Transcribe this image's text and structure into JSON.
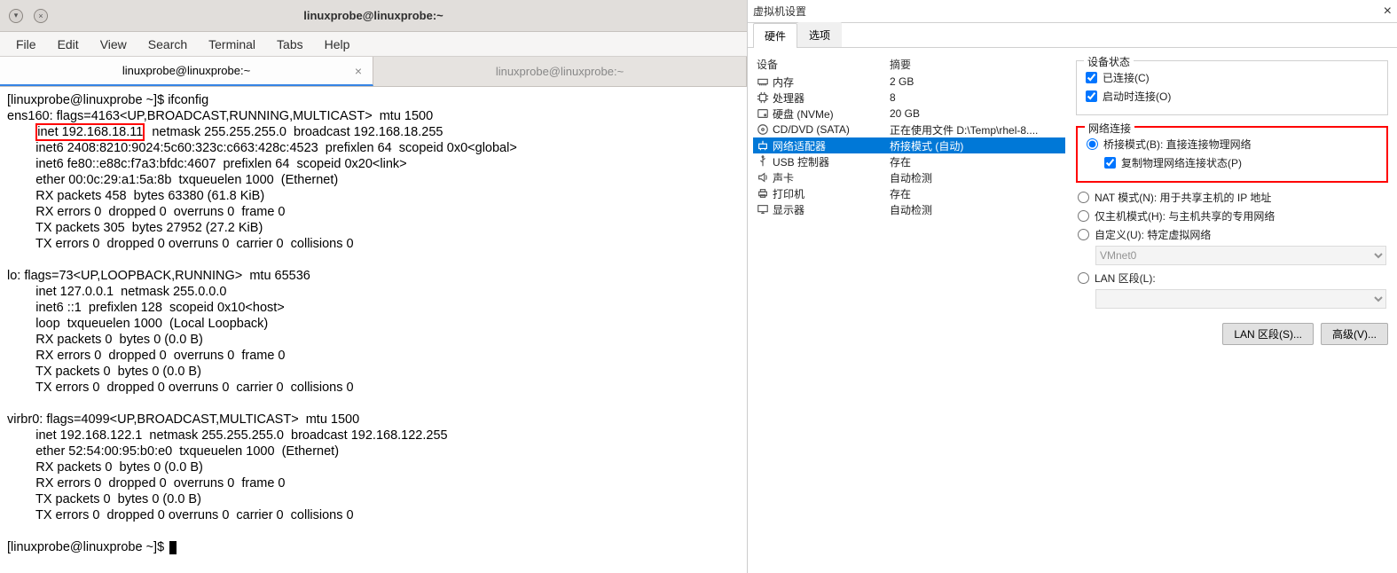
{
  "terminal_window": {
    "title": "linuxprobe@linuxprobe:~",
    "menus": [
      "File",
      "Edit",
      "View",
      "Search",
      "Terminal",
      "Tabs",
      "Help"
    ],
    "tabs": [
      {
        "label": "linuxprobe@linuxprobe:~",
        "active": true
      },
      {
        "label": "linuxprobe@linuxprobe:~",
        "active": false
      }
    ],
    "prompt1": "[linuxprobe@linuxprobe ~]$ ",
    "cmd": "ifconfig",
    "line_ens_flags": "ens160: flags=4163<UP,BROADCAST,RUNNING,MULTICAST>  mtu 1500",
    "line_inet_pre": "        ",
    "line_inet_hl": "inet 192.168.18.11",
    "line_inet_post": "  netmask 255.255.255.0  broadcast 192.168.18.255",
    "line_inet6a": "        inet6 2408:8210:9024:5c60:323c:c663:428c:4523  prefixlen 64  scopeid 0x0<global>",
    "line_inet6b": "        inet6 fe80::e88c:f7a3:bfdc:4607  prefixlen 64  scopeid 0x20<link>",
    "line_ether": "        ether 00:0c:29:a1:5a:8b  txqueuelen 1000  (Ethernet)",
    "line_rxp": "        RX packets 458  bytes 63380 (61.8 KiB)",
    "line_rxe": "        RX errors 0  dropped 0  overruns 0  frame 0",
    "line_txp": "        TX packets 305  bytes 27952 (27.2 KiB)",
    "line_txe": "        TX errors 0  dropped 0 overruns 0  carrier 0  collisions 0",
    "blank": "",
    "lo_flags": "lo: flags=73<UP,LOOPBACK,RUNNING>  mtu 65536",
    "lo_inet": "        inet 127.0.0.1  netmask 255.0.0.0",
    "lo_inet6": "        inet6 ::1  prefixlen 128  scopeid 0x10<host>",
    "lo_loop": "        loop  txqueuelen 1000  (Local Loopback)",
    "lo_rxp": "        RX packets 0  bytes 0 (0.0 B)",
    "lo_rxe": "        RX errors 0  dropped 0  overruns 0  frame 0",
    "lo_txp": "        TX packets 0  bytes 0 (0.0 B)",
    "lo_txe": "        TX errors 0  dropped 0 overruns 0  carrier 0  collisions 0",
    "vb_flags": "virbr0: flags=4099<UP,BROADCAST,MULTICAST>  mtu 1500",
    "vb_inet": "        inet 192.168.122.1  netmask 255.255.255.0  broadcast 192.168.122.255",
    "vb_ether": "        ether 52:54:00:95:b0:e0  txqueuelen 1000  (Ethernet)",
    "vb_rxp": "        RX packets 0  bytes 0 (0.0 B)",
    "vb_rxe": "        RX errors 0  dropped 0  overruns 0  frame 0",
    "vb_txp": "        TX packets 0  bytes 0 (0.0 B)",
    "vb_txe": "        TX errors 0  dropped 0 overruns 0  carrier 0  collisions 0",
    "prompt2": "[linuxprobe@linuxprobe ~]$ "
  },
  "vm_settings": {
    "title": "虚拟机设置",
    "tabs": {
      "hardware": "硬件",
      "options": "选项"
    },
    "headers": {
      "device": "设备",
      "summary": "摘要"
    },
    "devices": [
      {
        "name": "内存",
        "summary": "2 GB",
        "icon": "memory"
      },
      {
        "name": "处理器",
        "summary": "8",
        "icon": "cpu"
      },
      {
        "name": "硬盘 (NVMe)",
        "summary": "20 GB",
        "icon": "disk"
      },
      {
        "name": "CD/DVD (SATA)",
        "summary": "正在使用文件 D:\\Temp\\rhel-8....",
        "icon": "cd"
      },
      {
        "name": "网络适配器",
        "summary": "桥接模式 (自动)",
        "icon": "network",
        "selected": true
      },
      {
        "name": "USB 控制器",
        "summary": "存在",
        "icon": "usb"
      },
      {
        "name": "声卡",
        "summary": "自动检测",
        "icon": "sound"
      },
      {
        "name": "打印机",
        "summary": "存在",
        "icon": "printer"
      },
      {
        "name": "显示器",
        "summary": "自动检测",
        "icon": "display"
      }
    ],
    "device_state": {
      "legend": "设备状态",
      "connected": "已连接(C)",
      "connect_at_poweron": "启动时连接(O)"
    },
    "network": {
      "legend": "网络连接",
      "bridged": "桥接模式(B): 直接连接物理网络",
      "replicate": "复制物理网络连接状态(P)",
      "nat": "NAT 模式(N): 用于共享主机的 IP 地址",
      "hostonly": "仅主机模式(H): 与主机共享的专用网络",
      "custom": "自定义(U): 特定虚拟网络",
      "vmnet": "VMnet0",
      "lan": "LAN 区段(L):"
    },
    "buttons": {
      "lan_segments": "LAN 区段(S)...",
      "advanced": "高级(V)..."
    }
  }
}
